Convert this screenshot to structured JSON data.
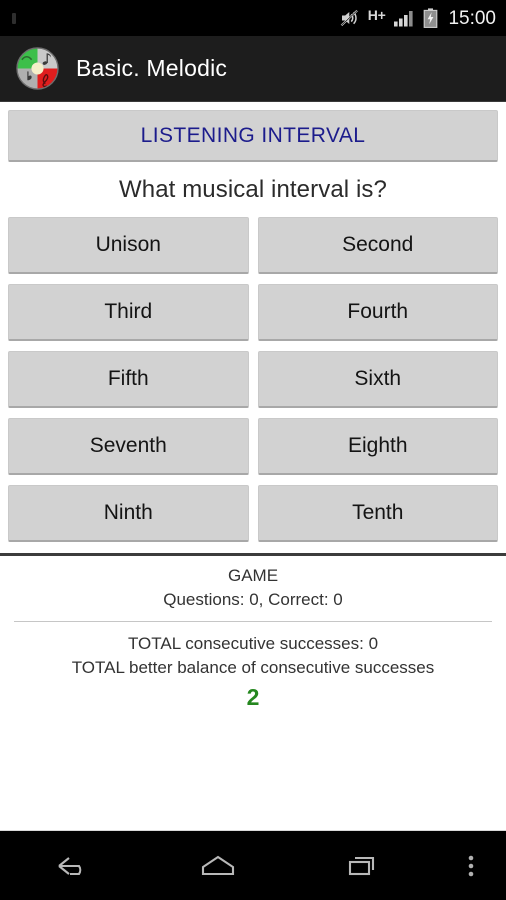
{
  "status_bar": {
    "network_type": "H+",
    "time": "15:00",
    "icons": {
      "mute": "mute-speaker-icon",
      "signal": "signal-bars-icon",
      "battery": "battery-charging-icon"
    }
  },
  "action_bar": {
    "app_icon": "app-logo-icon",
    "title": "Basic. Melodic"
  },
  "main": {
    "listening_button": {
      "label": "LISTENING INTERVAL",
      "color": "#1c1c8c"
    },
    "question": "What musical interval is?",
    "options": [
      {
        "label": "Unison"
      },
      {
        "label": "Second"
      },
      {
        "label": "Third"
      },
      {
        "label": "Fourth"
      },
      {
        "label": "Fifth"
      },
      {
        "label": "Sixth"
      },
      {
        "label": "Seventh"
      },
      {
        "label": "Eighth"
      },
      {
        "label": "Ninth"
      },
      {
        "label": "Tenth"
      }
    ],
    "stats": {
      "game_label": "GAME",
      "game_counts": "Questions: 0, Correct: 0",
      "total_consecutive": "TOTAL consecutive successes: 0",
      "total_best_label": "TOTAL better balance of consecutive successes",
      "total_best_value": "2",
      "total_best_color": "#25871f"
    }
  },
  "nav_bar": {
    "back": "back-arrow-icon",
    "home": "home-icon",
    "recents": "recent-apps-icon",
    "overflow": "overflow-menu-icon"
  }
}
